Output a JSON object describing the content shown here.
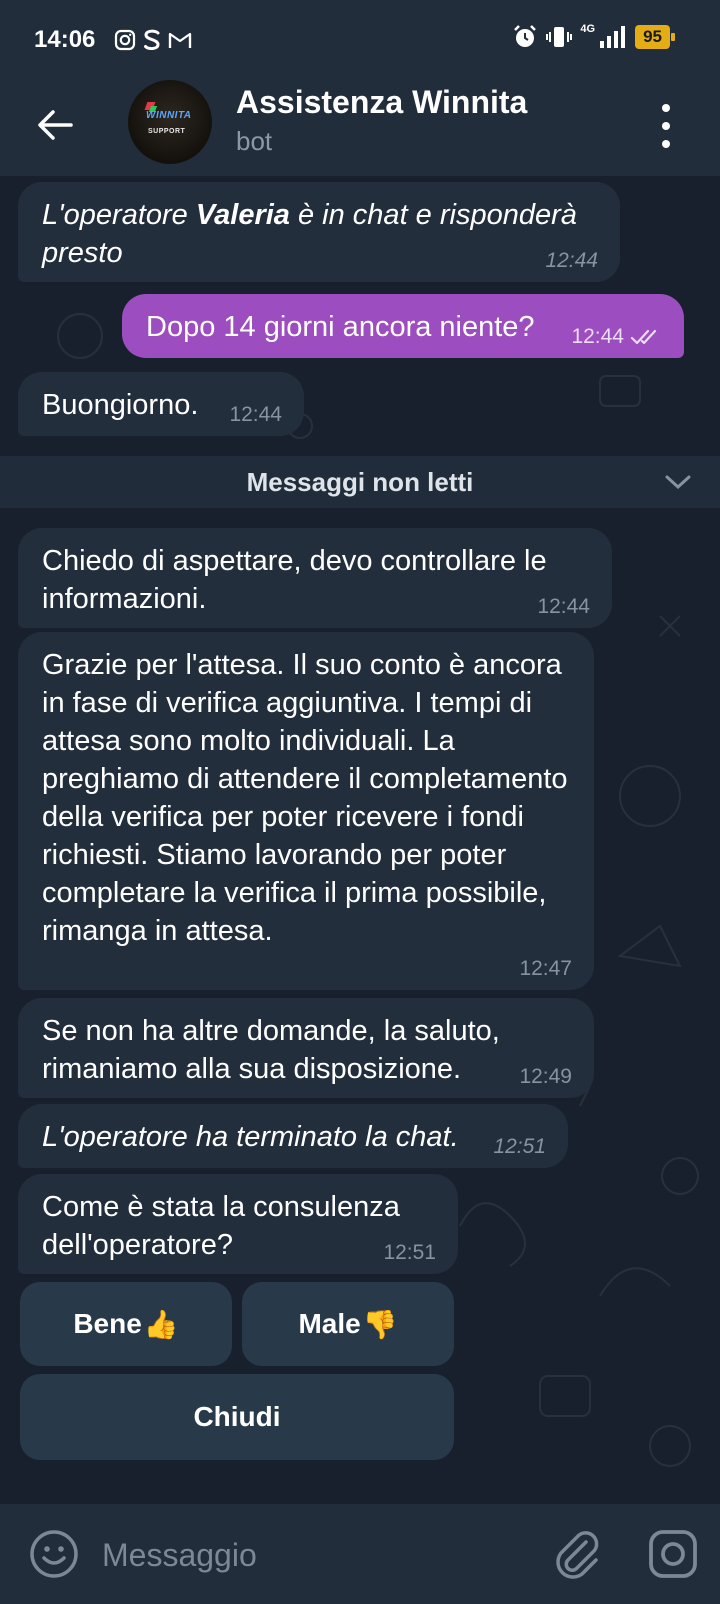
{
  "status_bar": {
    "time": "14:06",
    "left_icons": [
      "instagram-icon",
      "s-icon",
      "gmail-icon"
    ],
    "network": "4G",
    "battery": "95",
    "battery_color": "#e4ad16"
  },
  "header": {
    "title": "Assistenza Winnita",
    "subtitle": "bot",
    "avatar_brand": "WINNITA",
    "avatar_sub": "SUPPORT"
  },
  "messages": [
    {
      "id": 1,
      "direction": "in",
      "italic": true,
      "prefix": "L'operatore ",
      "bold": "Valeria",
      "suffix": " è in chat e risponderà presto",
      "time": "12:44"
    },
    {
      "id": 2,
      "direction": "out",
      "text": "Dopo 14 giorni ancora niente?",
      "time": "12:44",
      "status": "read"
    },
    {
      "id": 3,
      "direction": "in",
      "text": "Buongiorno.",
      "time": "12:44"
    },
    {
      "id": 4,
      "direction": "in",
      "text": "Chiedo di aspettare, devo controllare le informazioni.",
      "time": "12:44"
    },
    {
      "id": 5,
      "direction": "in",
      "text": "Grazie per l'attesa. Il suo conto è ancora in fase di verifica aggiuntiva. I tempi di attesa sono molto individuali. La preghiamo di attendere il completamento della verifica per poter ricevere i fondi richiesti. Stiamo lavorando per poter completare la verifica il prima possibile, rimanga in attesa.",
      "time": "12:47"
    },
    {
      "id": 6,
      "direction": "in",
      "text": "Se non ha altre domande, la saluto, rimaniamo alla sua disposizione.",
      "time": "12:49"
    },
    {
      "id": 7,
      "direction": "in",
      "italic": true,
      "text": "L'operatore ha terminato la chat.",
      "time": "12:51"
    },
    {
      "id": 8,
      "direction": "in",
      "text": "Come è stata la consulenza dell'operatore?",
      "time": "12:51"
    }
  ],
  "unread_divider": "Messaggi non letti",
  "keyboard": {
    "good": "Bene",
    "good_emoji": "👍",
    "bad": "Male",
    "bad_emoji": "👎",
    "close": "Chiudi"
  },
  "input": {
    "placeholder": "Messaggio"
  },
  "colors": {
    "background": "#17202c",
    "bar": "#212d3b",
    "incoming_bubble": "#222e3b",
    "outgoing_bubble": "#9c4dbf",
    "keyboard_button": "#28394a"
  }
}
